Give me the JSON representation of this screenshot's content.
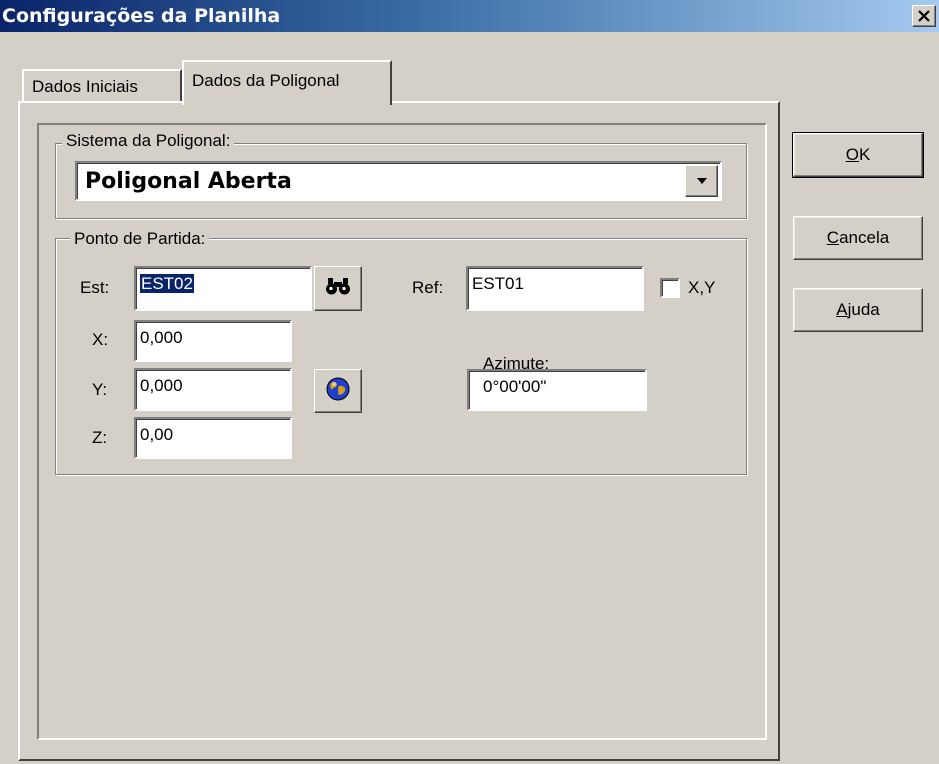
{
  "window": {
    "title": "Configurações da Planilha",
    "close_label": "x"
  },
  "tabs": [
    {
      "label": "Dados Iniciais",
      "active": false
    },
    {
      "label": "Dados da Poligonal",
      "active": true
    }
  ],
  "sistema": {
    "legend": "Sistema da Poligonal:",
    "selected": "Poligonal Aberta"
  },
  "ponto": {
    "legend": "Ponto de Partida:",
    "est_label": "Est:",
    "est_value": "EST02",
    "ref_label": "Ref:",
    "ref_value": "EST01",
    "xy_label": "X,Y",
    "xy_checked": false,
    "x_label": "X:",
    "x_value": "0,000",
    "y_label": "Y:",
    "y_value": "0,000",
    "z_label": "Z:",
    "z_value": "0,00",
    "azimute_label": "Azimute:",
    "azimute_value": "0°00'00\""
  },
  "buttons": {
    "ok": {
      "mnemonic": "O",
      "rest": "K"
    },
    "cancela": {
      "mnemonic": "C",
      "rest": "ancela"
    },
    "ajuda": {
      "mnemonic": "A",
      "rest": "juda"
    }
  },
  "icons": {
    "search": "binoculars-icon",
    "globe": "globe-icon",
    "dropdown": "chevron-down-icon"
  },
  "colors": {
    "titlebar_start": "#0a246a",
    "titlebar_end": "#a6caf0",
    "face": "#d4d0c8",
    "selection": "#0a246a"
  }
}
